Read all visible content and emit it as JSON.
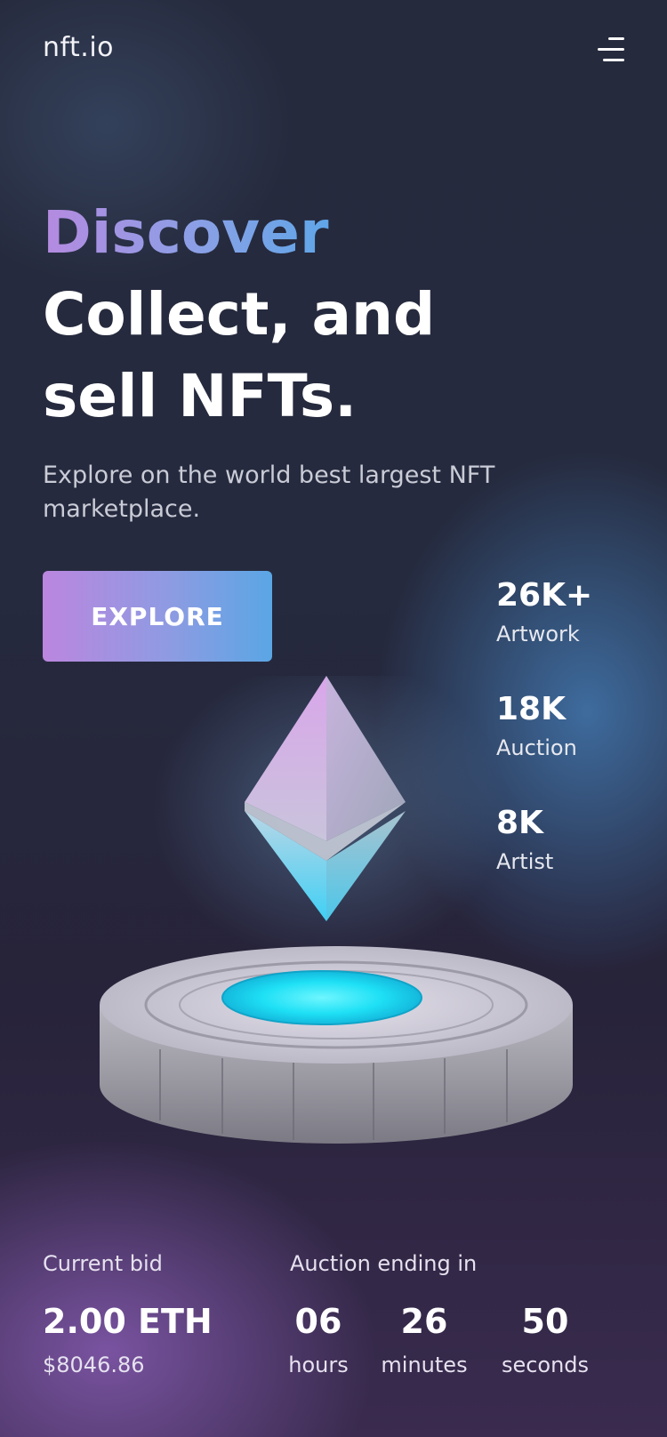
{
  "header": {
    "logo": "nft.io",
    "menu_icon": "hamburger-menu-icon"
  },
  "hero": {
    "title_highlight": "Discover",
    "title_line_1": "Collect, and",
    "title_line_2": "sell NFTs.",
    "subtitle": "Explore on the world best largest NFT marketplace.",
    "cta_label": "EXPLORE"
  },
  "stats": [
    {
      "value": "26K+",
      "label": "Artwork"
    },
    {
      "value": "18K",
      "label": "Auction"
    },
    {
      "value": "8K",
      "label": "Artist"
    }
  ],
  "artwork": {
    "icon": "ethereum-logo-icon"
  },
  "bid": {
    "label": "Current bid",
    "amount": "2.00 ETH",
    "usd": "$8046.86"
  },
  "auction": {
    "label": "Auction ending in",
    "hours": "06",
    "hours_label": "hours",
    "minutes": "26",
    "minutes_label": "minutes",
    "seconds": "50",
    "seconds_label": "seconds"
  },
  "colors": {
    "accent_purple": "#bb86df",
    "accent_blue": "#5aa6e5",
    "background": "#262a3d"
  }
}
